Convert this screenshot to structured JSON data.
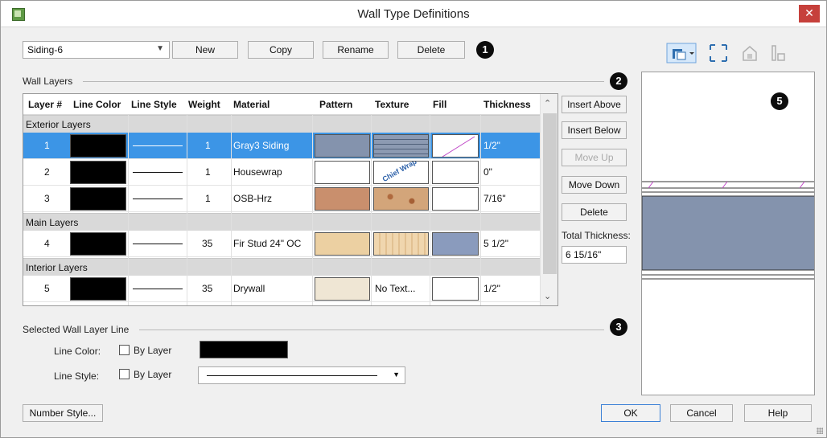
{
  "window": {
    "title": "Wall Type Definitions",
    "close_glyph": "✕"
  },
  "top": {
    "wall_type": "Siding-6",
    "new_label": "New",
    "copy_label": "Copy",
    "rename_label": "Rename",
    "delete_label": "Delete"
  },
  "badges": [
    "1",
    "2",
    "3",
    "5"
  ],
  "layers": {
    "title": "Wall Layers",
    "columns": [
      "Layer #",
      "Line Color",
      "Line Style",
      "Weight",
      "Material",
      "Pattern",
      "Texture",
      "Fill",
      "Thickness"
    ],
    "groups": [
      "Exterior Layers",
      "Main Layers",
      "Interior Layers"
    ],
    "rows": [
      {
        "num": "1",
        "weight": "1",
        "material": "Gray3 Siding",
        "thickness": "1/2\"",
        "pattern_color": "#8493ad",
        "texture": "siding",
        "fill": "hatch"
      },
      {
        "num": "2",
        "weight": "1",
        "material": "Housewrap",
        "thickness": "0\"",
        "pattern_color": "#ffffff",
        "texture": "housewrap",
        "fill": "white"
      },
      {
        "num": "3",
        "weight": "1",
        "material": "OSB-Hrz",
        "thickness": "7/16\"",
        "pattern_color": "#c98f6d",
        "texture": "osb",
        "fill": "white"
      },
      {
        "num": "4",
        "weight": "35",
        "material": "Fir Stud 24\" OC",
        "thickness": "5 1/2\"",
        "pattern_color": "#ecd0a2",
        "texture": "wood",
        "fill": "#8a9bbd"
      },
      {
        "num": "5",
        "weight": "35",
        "material": "Drywall",
        "thickness": "1/2\"",
        "pattern_color": "#efe6d4",
        "texture_text": "No Text...",
        "fill": "white"
      }
    ],
    "housewrap_text": "Chief Wrap",
    "selected_index": 0
  },
  "side": {
    "insert_above": "Insert Above",
    "insert_below": "Insert Below",
    "move_up": "Move Up",
    "move_down": "Move Down",
    "delete": "Delete",
    "total_label": "Total Thickness:",
    "total_value": "6 15/16\""
  },
  "selected_line": {
    "title": "Selected Wall Layer Line",
    "color_label": "Line Color:",
    "style_label": "Line Style:",
    "by_layer": "By Layer"
  },
  "bottom": {
    "number_style": "Number Style...",
    "ok": "OK",
    "cancel": "Cancel",
    "help": "Help"
  },
  "colors": {
    "selection": "#3c95e6",
    "group_bg": "#d9d9d9",
    "preview_core": "#8493ad",
    "hatch": "#c048c8"
  }
}
